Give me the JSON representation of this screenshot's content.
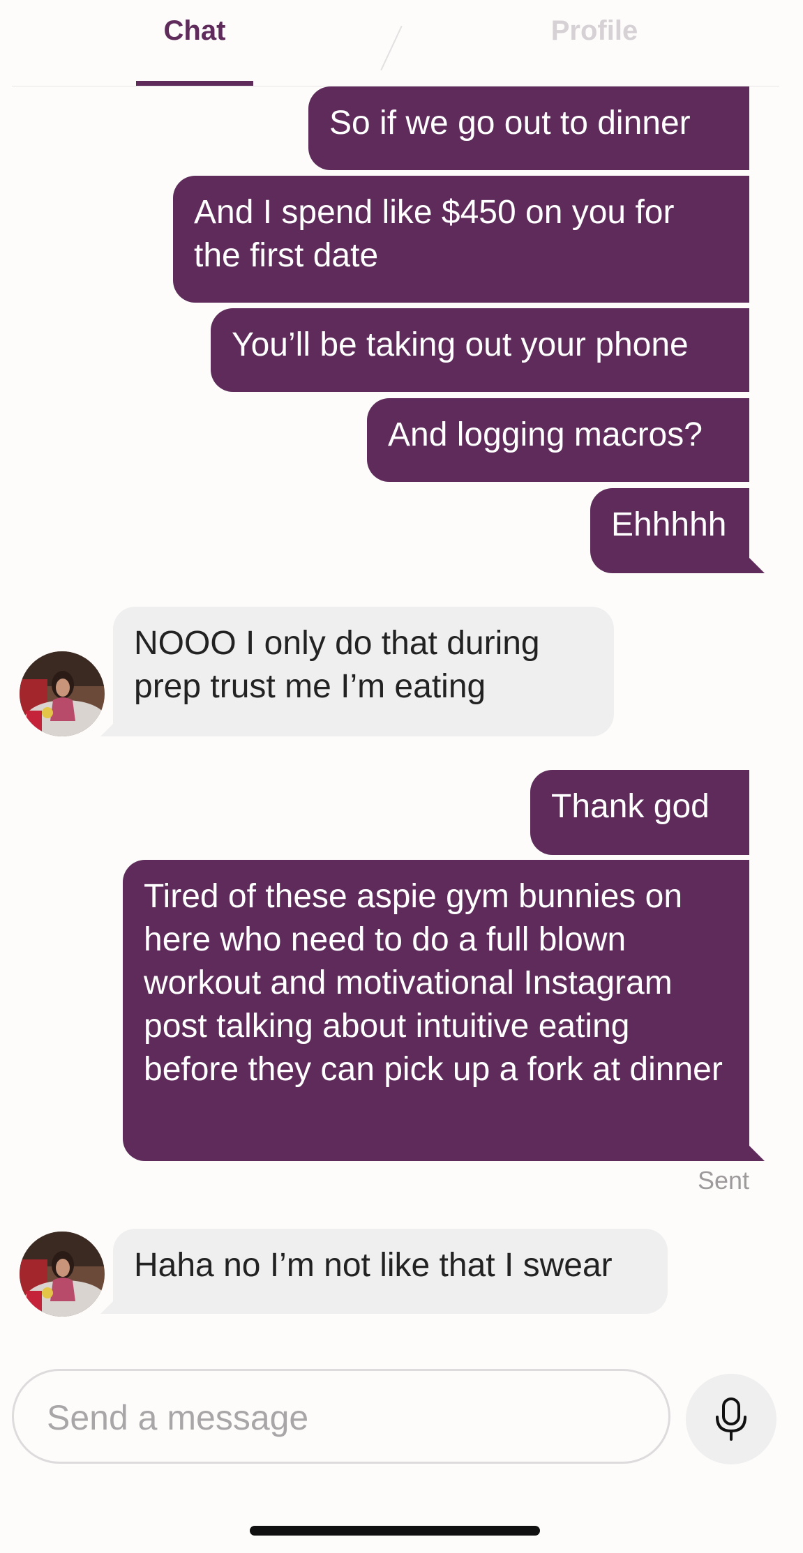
{
  "tabs": {
    "chat_label": "Chat",
    "profile_label": "Profile"
  },
  "messages": [
    {
      "direction": "outgoing",
      "text": "So if we go out to dinner"
    },
    {
      "direction": "outgoing",
      "text": "And I spend like $450 on you for the first date"
    },
    {
      "direction": "outgoing",
      "text": "You’ll be taking out your phone"
    },
    {
      "direction": "outgoing",
      "text": "And logging macros?"
    },
    {
      "direction": "outgoing",
      "text": "Ehhhhh"
    },
    {
      "direction": "incoming",
      "text": "NOOO I only do that during prep trust me I’m eating"
    },
    {
      "direction": "outgoing",
      "text": "Thank god"
    },
    {
      "direction": "outgoing",
      "text": "Tired of these aspie gym bunnies on here who need to do a full blown workout and motivational Instagram post talking about intuitive eating before they can pick up a fork at dinner"
    },
    {
      "direction": "incoming",
      "text": "Haha no I’m not like that I swear"
    }
  ],
  "status": {
    "sent_label": "Sent"
  },
  "composer": {
    "placeholder": "Send a message",
    "mic_icon": "microphone-icon"
  },
  "colors": {
    "accent": "#5e2b5b",
    "incoming_bubble": "#efefef",
    "background": "#fdfcfb"
  }
}
